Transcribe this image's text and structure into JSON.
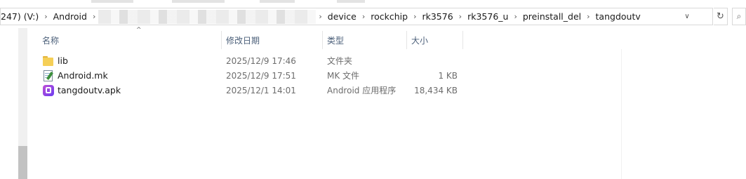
{
  "address_bar": {
    "crumbs_left": [
      {
        "label": "247) (V:)"
      },
      {
        "label": "Android"
      }
    ],
    "crumbs_right": [
      {
        "label": "device"
      },
      {
        "label": "rockchip"
      },
      {
        "label": "rk3576"
      },
      {
        "label": "rk3576_u"
      },
      {
        "label": "preinstall_del"
      },
      {
        "label": "tangdoutv"
      }
    ],
    "separator": "›",
    "dropdown_glyph": "∨",
    "refresh_glyph": "↻",
    "search_glyph": "⌕"
  },
  "columns": {
    "name": "名称",
    "date": "修改日期",
    "type": "类型",
    "size": "大小",
    "sort_glyph": "^"
  },
  "files": [
    {
      "name": "lib",
      "date": "2025/12/9 17:46",
      "type": "文件夹",
      "size": "",
      "icon": "folder-icon"
    },
    {
      "name": "Android.mk",
      "date": "2025/12/9 17:51",
      "type": "MK 文件",
      "size": "1 KB",
      "icon": "mk-file-icon"
    },
    {
      "name": "tangdoutv.apk",
      "date": "2025/12/1 14:01",
      "type": "Android 应用程序",
      "size": "18,434 KB",
      "icon": "apk-file-icon"
    }
  ],
  "colors": {
    "header_text": "#4c607a",
    "detail_text": "#6d6d6d",
    "folder": "#f5cf57"
  }
}
